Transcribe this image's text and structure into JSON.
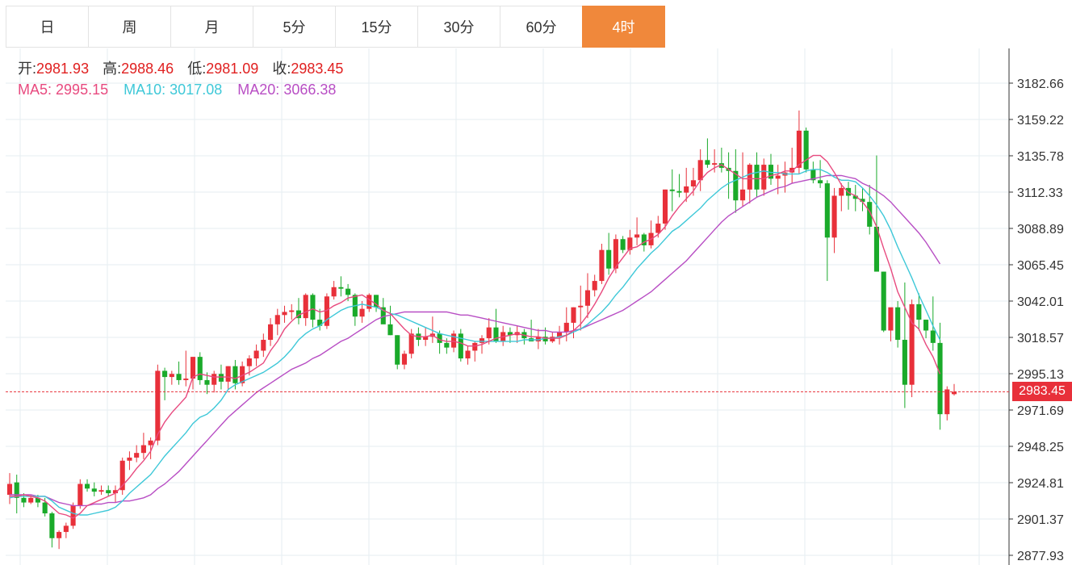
{
  "tabs": [
    {
      "label": "日",
      "active": false
    },
    {
      "label": "周",
      "active": false
    },
    {
      "label": "月",
      "active": false
    },
    {
      "label": "5分",
      "active": false
    },
    {
      "label": "15分",
      "active": false
    },
    {
      "label": "30分",
      "active": false
    },
    {
      "label": "60分",
      "active": false
    },
    {
      "label": "4时",
      "active": true
    }
  ],
  "info": {
    "open_label": "开:",
    "open": "2981.93",
    "high_label": "高:",
    "high": "2988.46",
    "low_label": "低:",
    "low": "2981.09",
    "close_label": "收:",
    "close": "2983.45",
    "ma5_label": "MA5:",
    "ma5": "2995.15",
    "ma10_label": "MA10:",
    "ma10": "3017.08",
    "ma20_label": "MA20:",
    "ma20": "3066.38"
  },
  "current_price": "2983.45",
  "colors": {
    "up": "#e8303a",
    "down": "#1aaa2a",
    "ma5": "#e84a7f",
    "ma10": "#3ec8d8",
    "ma20": "#b84ec4",
    "accent": "#f0883b",
    "grid": "#e6eef2"
  },
  "chart_data": {
    "type": "candlestick",
    "y_ticks": [
      "3182.66",
      "3159.22",
      "3135.78",
      "3112.33",
      "3088.89",
      "3065.45",
      "3042.01",
      "3018.57",
      "2995.13",
      "2971.69",
      "2948.25",
      "2924.81",
      "2901.37",
      "2877.93"
    ],
    "ylim": [
      2877.93,
      3182.66
    ],
    "last_close": 2983.45,
    "ohlc": [
      [
        2917,
        2931,
        2911,
        2924
      ],
      [
        2925,
        2930,
        2905,
        2915
      ],
      [
        2915,
        2918,
        2909,
        2912
      ],
      [
        2912,
        2917,
        2911,
        2915
      ],
      [
        2915,
        2917,
        2909,
        2912
      ],
      [
        2912,
        2915,
        2903,
        2905
      ],
      [
        2905,
        2906,
        2883,
        2889
      ],
      [
        2889,
        2894,
        2882,
        2893
      ],
      [
        2893,
        2899,
        2889,
        2897
      ],
      [
        2897,
        2912,
        2895,
        2910
      ],
      [
        2910,
        2927,
        2908,
        2924
      ],
      [
        2924,
        2927,
        2919,
        2921
      ],
      [
        2921,
        2925,
        2916,
        2919
      ],
      [
        2919,
        2923,
        2917,
        2920
      ],
      [
        2920,
        2923,
        2916,
        2918
      ],
      [
        2918,
        2923,
        2912,
        2920
      ],
      [
        2920,
        2941,
        2917,
        2939
      ],
      [
        2939,
        2945,
        2933,
        2941
      ],
      [
        2941,
        2949,
        2938,
        2944
      ],
      [
        2944,
        2957,
        2940,
        2949
      ],
      [
        2949,
        2954,
        2940,
        2952
      ],
      [
        2952,
        3001,
        2949,
        2997
      ],
      [
        2997,
        2999,
        2978,
        2993
      ],
      [
        2993,
        2997,
        2988,
        2995
      ],
      [
        2995,
        3003,
        2988,
        2991
      ],
      [
        2991,
        3010,
        2987,
        2992
      ],
      [
        2992,
        3006,
        2985,
        3006
      ],
      [
        3006,
        3009,
        2988,
        2991
      ],
      [
        2991,
        2996,
        2982,
        2988
      ],
      [
        2988,
        2997,
        2983,
        2995
      ],
      [
        2995,
        3001,
        2985,
        2990
      ],
      [
        2990,
        3000,
        2985,
        3000
      ],
      [
        3000,
        3004,
        2985,
        2989
      ],
      [
        2989,
        3003,
        2987,
        3000
      ],
      [
        3000,
        3007,
        2994,
        3005
      ],
      [
        3005,
        3014,
        3000,
        3010
      ],
      [
        3010,
        3021,
        3006,
        3017
      ],
      [
        3017,
        3031,
        3013,
        3027
      ],
      [
        3027,
        3037,
        3020,
        3033
      ],
      [
        3033,
        3039,
        3028,
        3035
      ],
      [
        3035,
        3040,
        3030,
        3036
      ],
      [
        3036,
        3044,
        3027,
        3031
      ],
      [
        3031,
        3047,
        3026,
        3046
      ],
      [
        3046,
        3047,
        3025,
        3030
      ],
      [
        3030,
        3037,
        3023,
        3026
      ],
      [
        3026,
        3047,
        3024,
        3045
      ],
      [
        3045,
        3055,
        3043,
        3051
      ],
      [
        3051,
        3058,
        3045,
        3050
      ],
      [
        3050,
        3053,
        3042,
        3046
      ],
      [
        3046,
        3047,
        3026,
        3032
      ],
      [
        3032,
        3042,
        3028,
        3037
      ],
      [
        3037,
        3047,
        3035,
        3046
      ],
      [
        3046,
        3046,
        3035,
        3038
      ],
      [
        3038,
        3044,
        3028,
        3027
      ],
      [
        3027,
        3039,
        3020,
        3020
      ],
      [
        3020,
        3020,
        2998,
        3001
      ],
      [
        3001,
        3010,
        2998,
        3008
      ],
      [
        3008,
        3024,
        3005,
        3021
      ],
      [
        3021,
        3025,
        3013,
        3017
      ],
      [
        3017,
        3025,
        3013,
        3019
      ],
      [
        3019,
        3032,
        3015,
        3021
      ],
      [
        3021,
        3023,
        3008,
        3015
      ],
      [
        3015,
        3018,
        3008,
        3012
      ],
      [
        3012,
        3023,
        3009,
        3021
      ],
      [
        3021,
        3024,
        3003,
        3005
      ],
      [
        3005,
        3013,
        3001,
        3010
      ],
      [
        3010,
        3016,
        3003,
        3015
      ],
      [
        3015,
        3020,
        3008,
        3018
      ],
      [
        3018,
        3031,
        3014,
        3025
      ],
      [
        3025,
        3037,
        3015,
        3016
      ],
      [
        3016,
        3026,
        3013,
        3022
      ],
      [
        3022,
        3025,
        3015,
        3020
      ],
      [
        3020,
        3026,
        3015,
        3022
      ],
      [
        3022,
        3024,
        3014,
        3018
      ],
      [
        3018,
        3030,
        3016,
        3016
      ],
      [
        3016,
        3024,
        3011,
        3019
      ],
      [
        3019,
        3025,
        3014,
        3016
      ],
      [
        3016,
        3022,
        3015,
        3019
      ],
      [
        3019,
        3026,
        3014,
        3022
      ],
      [
        3022,
        3038,
        3016,
        3028
      ],
      [
        3028,
        3038,
        3018,
        3038
      ],
      [
        3038,
        3052,
        3023,
        3039
      ],
      [
        3039,
        3060,
        3031,
        3049
      ],
      [
        3049,
        3059,
        3045,
        3055
      ],
      [
        3055,
        3079,
        3053,
        3075
      ],
      [
        3075,
        3086,
        3059,
        3063
      ],
      [
        3063,
        3085,
        3060,
        3082
      ],
      [
        3082,
        3084,
        3073,
        3075
      ],
      [
        3075,
        3088,
        3072,
        3083
      ],
      [
        3083,
        3096,
        3078,
        3085
      ],
      [
        3085,
        3086,
        3074,
        3078
      ],
      [
        3078,
        3094,
        3076,
        3086
      ],
      [
        3086,
        3097,
        3083,
        3092
      ],
      [
        3092,
        3114,
        3088,
        3114
      ],
      [
        3114,
        3127,
        3100,
        3113
      ],
      [
        3113,
        3124,
        3109,
        3112
      ],
      [
        3112,
        3128,
        3106,
        3116
      ],
      [
        3116,
        3128,
        3110,
        3120
      ],
      [
        3120,
        3140,
        3113,
        3133
      ],
      [
        3133,
        3147,
        3128,
        3130
      ],
      [
        3130,
        3140,
        3125,
        3131
      ],
      [
        3131,
        3141,
        3125,
        3128
      ],
      [
        3128,
        3138,
        3108,
        3126
      ],
      [
        3126,
        3140,
        3099,
        3107
      ],
      [
        3107,
        3138,
        3103,
        3114
      ],
      [
        3114,
        3131,
        3105,
        3130
      ],
      [
        3130,
        3138,
        3109,
        3114
      ],
      [
        3114,
        3134,
        3110,
        3130
      ],
      [
        3130,
        3137,
        3117,
        3121
      ],
      [
        3121,
        3130,
        3111,
        3123
      ],
      [
        3123,
        3132,
        3112,
        3125
      ],
      [
        3125,
        3141,
        3118,
        3128
      ],
      [
        3128,
        3165,
        3124,
        3152
      ],
      [
        3152,
        3154,
        3125,
        3127
      ],
      [
        3127,
        3132,
        3118,
        3120
      ],
      [
        3120,
        3133,
        3115,
        3118
      ],
      [
        3118,
        3120,
        3055,
        3083
      ],
      [
        3083,
        3115,
        3073,
        3110
      ],
      [
        3110,
        3118,
        3100,
        3115
      ],
      [
        3115,
        3119,
        3101,
        3110
      ],
      [
        3110,
        3117,
        3100,
        3108
      ],
      [
        3108,
        3115,
        3100,
        3106
      ],
      [
        3106,
        3117,
        3085,
        3090
      ],
      [
        3090,
        3136,
        3073,
        3061
      ],
      [
        3061,
        3061,
        3022,
        3023
      ],
      [
        3023,
        3030,
        3016,
        3038
      ],
      [
        3038,
        3042,
        3012,
        3017
      ],
      [
        3017,
        3054,
        2973,
        2988
      ],
      [
        2988,
        3043,
        2980,
        3040
      ],
      [
        3040,
        3047,
        3023,
        3030
      ],
      [
        3030,
        3030,
        3018,
        3023
      ],
      [
        3023,
        3045,
        3010,
        3015
      ],
      [
        3015,
        3028,
        2959,
        2969
      ],
      [
        2969,
        2987,
        2965,
        2985
      ],
      [
        2981.93,
        2988.46,
        2981.09,
        2983.45
      ]
    ],
    "ma5": [
      2916,
      2916,
      2917,
      2916,
      2915,
      2913,
      2909,
      2905,
      2904,
      2902,
      2905,
      2910,
      2912,
      2914,
      2916,
      2918,
      2923,
      2928,
      2934,
      2939,
      2945,
      2956,
      2964,
      2970,
      2975,
      2980,
      2993,
      2995,
      2994,
      2993,
      2993,
      2993,
      2992,
      2994,
      2996,
      2999,
      3002,
      3010,
      3016,
      3024,
      3029,
      3033,
      3035,
      3037,
      3035,
      3036,
      3039,
      3041,
      3044,
      3045,
      3046,
      3043,
      3040,
      3036,
      3034,
      3029,
      3024,
      3020,
      3019,
      3019,
      3020,
      3017,
      3016,
      3016,
      3015,
      3013,
      3013,
      3014,
      3016,
      3018,
      3019,
      3020,
      3021,
      3020,
      3019,
      3019,
      3018,
      3018,
      3018,
      3020,
      3023,
      3027,
      3033,
      3040,
      3048,
      3057,
      3064,
      3070,
      3076,
      3077,
      3080,
      3082,
      3085,
      3090,
      3097,
      3103,
      3108,
      3113,
      3120,
      3125,
      3128,
      3130,
      3127,
      3124,
      3121,
      3121,
      3121,
      3121,
      3123,
      3124,
      3126,
      3126,
      3130,
      3133,
      3136,
      3136,
      3132,
      3125,
      3117,
      3112,
      3110,
      3106,
      3100,
      3090,
      3076,
      3063,
      3048,
      3038,
      3028,
      3024,
      3014,
      3006,
      2995
    ],
    "ma10": [
      2915,
      2916,
      2916,
      2916,
      2916,
      2916,
      2913,
      2909,
      2907,
      2905,
      2904,
      2904,
      2905,
      2906,
      2907,
      2909,
      2913,
      2918,
      2922,
      2926,
      2930,
      2936,
      2942,
      2947,
      2952,
      2957,
      2963,
      2967,
      2969,
      2973,
      2978,
      2985,
      2988,
      2990,
      2992,
      2994,
      2996,
      2999,
      3002,
      3006,
      3011,
      3017,
      3021,
      3024,
      3026,
      3030,
      3033,
      3036,
      3038,
      3039,
      3040,
      3039,
      3038,
      3036,
      3034,
      3033,
      3031,
      3029,
      3027,
      3025,
      3023,
      3021,
      3020,
      3019,
      3018,
      3017,
      3016,
      3016,
      3016,
      3016,
      3016,
      3016,
      3016,
      3017,
      3017,
      3017,
      3018,
      3018,
      3019,
      3020,
      3022,
      3024,
      3027,
      3031,
      3035,
      3040,
      3046,
      3051,
      3057,
      3063,
      3068,
      3073,
      3077,
      3082,
      3087,
      3090,
      3094,
      3098,
      3102,
      3107,
      3111,
      3115,
      3118,
      3120,
      3122,
      3124,
      3125,
      3126,
      3125,
      3125,
      3124,
      3124,
      3124,
      3126,
      3127,
      3127,
      3125,
      3122,
      3120,
      3120,
      3119,
      3115,
      3110,
      3104,
      3097,
      3088,
      3077,
      3067,
      3057,
      3046,
      3036,
      3026,
      3017
    ],
    "ma20": [
      2917,
      2917,
      2917,
      2917,
      2916,
      2916,
      2914,
      2912,
      2911,
      2910,
      2910,
      2910,
      2911,
      2911,
      2912,
      2912,
      2913,
      2913,
      2914,
      2915,
      2917,
      2921,
      2924,
      2928,
      2932,
      2937,
      2942,
      2947,
      2952,
      2957,
      2962,
      2967,
      2971,
      2975,
      2979,
      2983,
      2986,
      2989,
      2992,
      2995,
      2998,
      3000,
      3002,
      3005,
      3007,
      3010,
      3013,
      3016,
      3018,
      3021,
      3024,
      3027,
      3030,
      3032,
      3033,
      3034,
      3035,
      3035,
      3035,
      3035,
      3035,
      3035,
      3035,
      3034,
      3033,
      3033,
      3032,
      3031,
      3030,
      3029,
      3028,
      3027,
      3026,
      3025,
      3024,
      3023,
      3023,
      3022,
      3022,
      3022,
      3023,
      3024,
      3026,
      3028,
      3030,
      3032,
      3034,
      3036,
      3039,
      3042,
      3045,
      3048,
      3052,
      3056,
      3060,
      3064,
      3068,
      3073,
      3078,
      3083,
      3088,
      3093,
      3097,
      3100,
      3103,
      3106,
      3109,
      3111,
      3113,
      3115,
      3116,
      3118,
      3119,
      3120,
      3121,
      3122,
      3123,
      3123,
      3123,
      3122,
      3121,
      3118,
      3116,
      3113,
      3110,
      3106,
      3101,
      3096,
      3091,
      3086,
      3080,
      3073,
      3066
    ]
  }
}
